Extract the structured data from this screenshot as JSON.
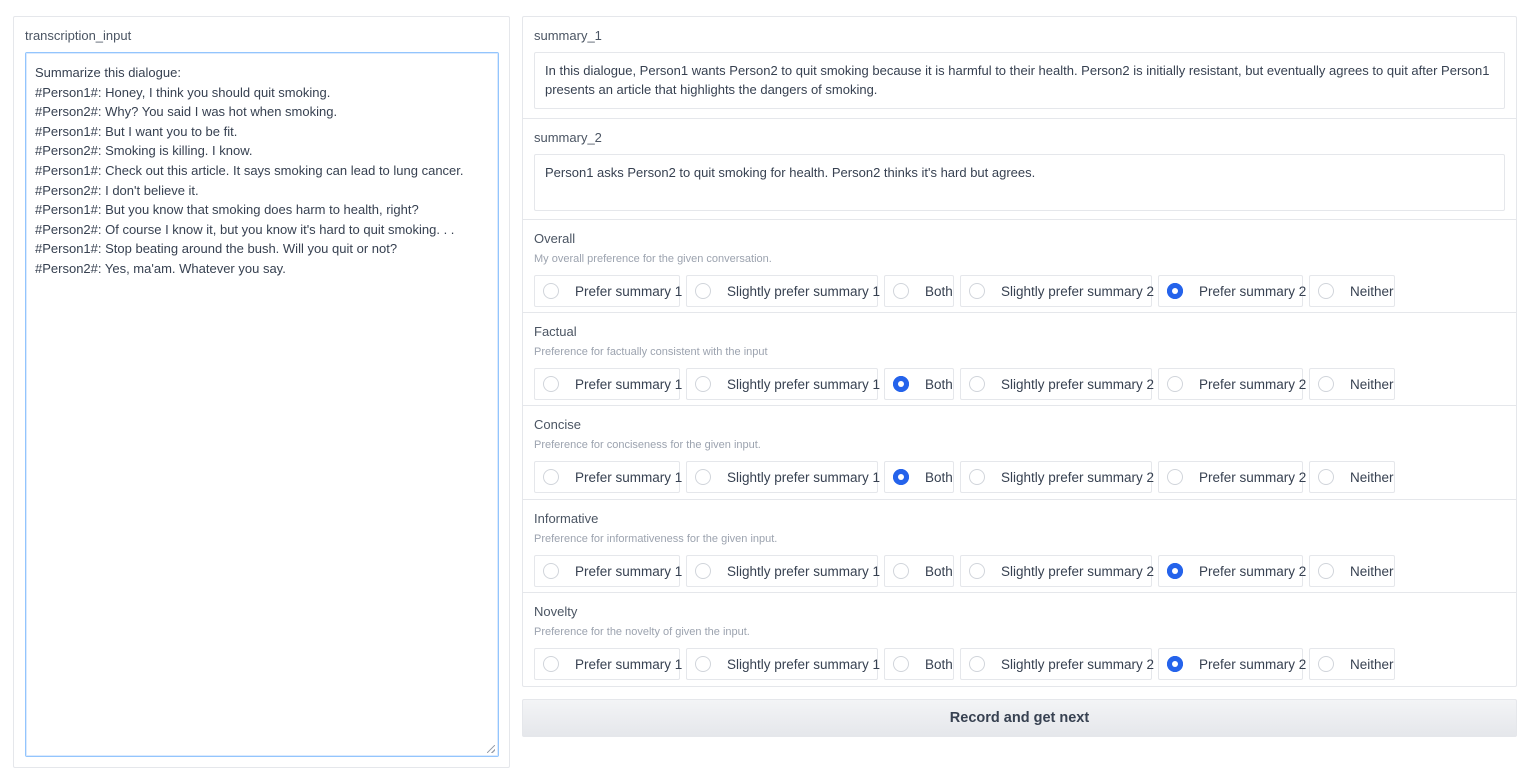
{
  "transcription": {
    "label": "transcription_input",
    "value": "Summarize this dialogue:\n#Person1#: Honey, I think you should quit smoking.\n#Person2#: Why? You said I was hot when smoking.\n#Person1#: But I want you to be fit.\n#Person2#: Smoking is killing. I know.\n#Person1#: Check out this article. It says smoking can lead to lung cancer.\n#Person2#: I don't believe it.\n#Person1#: But you know that smoking does harm to health, right?\n#Person2#: Of course I know it, but you know it's hard to quit smoking. . .\n#Person1#: Stop beating around the bush. Will you quit or not?\n#Person2#: Yes, ma'am. Whatever you say."
  },
  "summary_1": {
    "label": "summary_1",
    "text": "In this dialogue, Person1 wants Person2 to quit smoking because it is harmful to their health. Person2 is initially resistant, but eventually agrees to quit after Person1 presents an article that highlights the dangers of smoking."
  },
  "summary_2": {
    "label": "summary_2",
    "text": "Person1 asks Person2 to quit smoking for health. Person2 thinks it's hard but agrees."
  },
  "options": [
    "Prefer summary 1",
    "Slightly prefer summary 1",
    "Both",
    "Slightly prefer summary 2",
    "Prefer summary 2",
    "Neither"
  ],
  "criteria": [
    {
      "label": "Overall",
      "description": "My overall preference for the given conversation.",
      "selected": "Prefer summary 2"
    },
    {
      "label": "Factual",
      "description": "Preference for factually consistent with the input",
      "selected": "Both"
    },
    {
      "label": "Concise",
      "description": "Preference for conciseness for the given input.",
      "selected": "Both"
    },
    {
      "label": "Informative",
      "description": "Preference for informativeness for the given input.",
      "selected": "Prefer summary 2"
    },
    {
      "label": "Novelty",
      "description": "Preference for the novelty of given the input.",
      "selected": "Prefer summary 2"
    }
  ],
  "colors": {
    "accent": "#2563eb",
    "border": "#e5e7eb"
  },
  "submit_label": "Record and get next"
}
